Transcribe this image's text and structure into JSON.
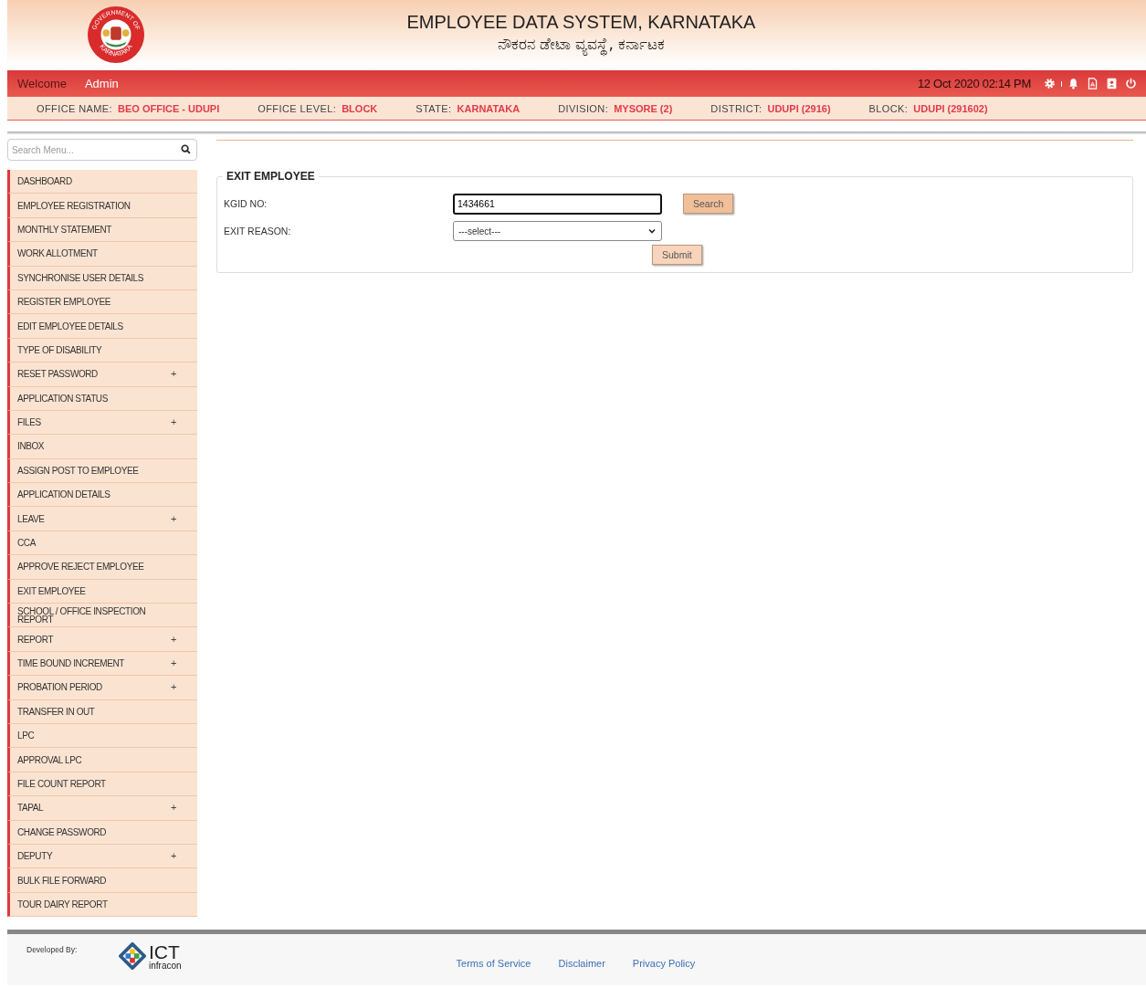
{
  "header": {
    "title": "EMPLOYEE DATA SYSTEM, KARNATAKA",
    "subtitle": "ನೌಕರನ ಡೇಟಾ ವ್ಯವಸ್ಥೆ, ಕರ್ನಾಟಕ",
    "logo_text_top": "GOVERNMENT OF",
    "logo_text_bottom": "KARNATAKA"
  },
  "top_bar": {
    "welcome": "Welcome",
    "user": "Admin",
    "datetime": "12 Oct 2020 02:14 PM"
  },
  "office_info": [
    {
      "label": "OFFICE NAME:",
      "value": "BEO OFFICE - UDUPI"
    },
    {
      "label": "OFFICE LEVEL:",
      "value": "BLOCK"
    },
    {
      "label": "STATE:",
      "value": "KARNATAKA"
    },
    {
      "label": "DIVISION:",
      "value": "MYSORE (2)"
    },
    {
      "label": "DISTRICT:",
      "value": "UDUPI (2916)"
    },
    {
      "label": "BLOCK:",
      "value": "UDUPI (291602)"
    }
  ],
  "sidebar": {
    "search_placeholder": "Search Menu...",
    "items": [
      {
        "label": "DASHBOARD"
      },
      {
        "label": "EMPLOYEE REGISTRATION"
      },
      {
        "label": "MONTHLY STATEMENT"
      },
      {
        "label": "WORK ALLOTMENT"
      },
      {
        "label": "SYNCHRONISE USER DETAILS"
      },
      {
        "label": "REGISTER EMPLOYEE"
      },
      {
        "label": "EDIT EMPLOYEE DETAILS"
      },
      {
        "label": "TYPE OF DISABILITY"
      },
      {
        "label": "RESET PASSWORD",
        "expander": "+"
      },
      {
        "label": "APPLICATION STATUS"
      },
      {
        "label": "FILES",
        "expander": "+"
      },
      {
        "label": "INBOX"
      },
      {
        "label": "ASSIGN POST TO EMPLOYEE"
      },
      {
        "label": "APPLICATION DETAILS"
      },
      {
        "label": "LEAVE",
        "expander": "+"
      },
      {
        "label": "CCA"
      },
      {
        "label": "APPROVE REJECT EMPLOYEE"
      },
      {
        "label": "EXIT EMPLOYEE"
      },
      {
        "label": "SCHOOL / OFFICE INSPECTION REPORT"
      },
      {
        "label": "REPORT",
        "expander": "+"
      },
      {
        "label": "TIME BOUND INCREMENT",
        "expander": "+"
      },
      {
        "label": "PROBATION PERIOD",
        "expander": "+"
      },
      {
        "label": "TRANSFER IN OUT"
      },
      {
        "label": "LPC"
      },
      {
        "label": "APPROVAL LPC"
      },
      {
        "label": "FILE COUNT REPORT"
      },
      {
        "label": "TAPAL",
        "expander": "+"
      },
      {
        "label": "CHANGE PASSWORD"
      },
      {
        "label": "DEPUTY",
        "expander": "+"
      },
      {
        "label": "BULK FILE FORWARD"
      },
      {
        "label": "TOUR DAIRY REPORT"
      }
    ]
  },
  "form": {
    "title": "EXIT EMPLOYEE",
    "kgid_label": "KGID NO:",
    "kgid_value": "1434661",
    "search_button": "Search",
    "reason_label": "EXIT REASON:",
    "reason_value": "---select---",
    "submit_button": "Submit"
  },
  "footer": {
    "developed_by": "Developed By:",
    "logo_name": "ICT",
    "logo_sub": "infracon",
    "links": [
      "Terms of Service",
      "Disclaimer",
      "Privacy Policy"
    ]
  }
}
